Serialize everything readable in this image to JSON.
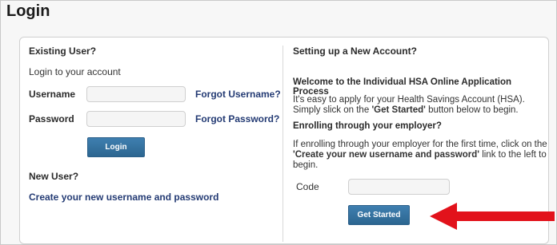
{
  "page": {
    "title": "Login"
  },
  "existing_user": {
    "heading": "Existing User?",
    "subtitle": "Login to your account",
    "username_label": "Username",
    "username_value": "",
    "password_label": "Password",
    "password_value": "",
    "forgot_username": "Forgot Username?",
    "forgot_password": "Forgot Password?",
    "login_button": "Login"
  },
  "new_user": {
    "heading": "New User?",
    "create_link": "Create your new username and password"
  },
  "new_account": {
    "heading": "Setting up a New Account?",
    "welcome_heading": "Welcome to the Individual HSA Online Application Process",
    "intro_line1": "It's easy to apply for your Health Savings Account (HSA).",
    "intro_line2_pre": "Simply slick on the ",
    "intro_line2_bold": "'Get Started'",
    "intro_line2_post": " button below to begin.",
    "employer_heading": "Enrolling through your employer?",
    "employer_line1": "If enrolling through your employer for the first time, click on the",
    "employer_line2_bold": "'Create your new username and password'",
    "employer_line2_post": " link to the left to",
    "employer_line3": "begin.",
    "code_label": "Code",
    "code_value": "",
    "get_started_button": "Get Started"
  },
  "annotation": {
    "arrow_color": "#e2121b",
    "arrow_icon": "left-arrow-icon"
  },
  "colors": {
    "link": "#243b74",
    "button": "#2c6690",
    "panel_border": "#d0d0d0"
  }
}
